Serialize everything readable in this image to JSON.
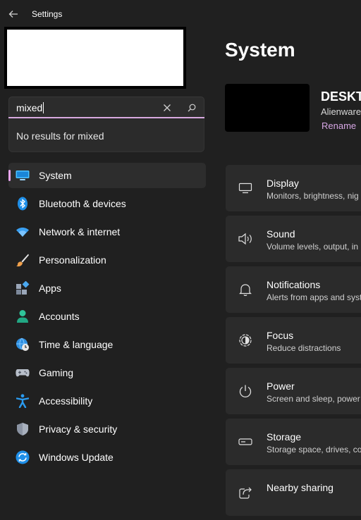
{
  "app": {
    "title": "Settings"
  },
  "search": {
    "value": "mixed",
    "no_results": "No results for mixed"
  },
  "sidebar": {
    "items": [
      {
        "label": "System",
        "icon": "monitor-icon",
        "selected": true
      },
      {
        "label": "Bluetooth & devices",
        "icon": "bluetooth-icon"
      },
      {
        "label": "Network & internet",
        "icon": "wifi-icon"
      },
      {
        "label": "Personalization",
        "icon": "brush-icon"
      },
      {
        "label": "Apps",
        "icon": "apps-icon"
      },
      {
        "label": "Accounts",
        "icon": "person-icon"
      },
      {
        "label": "Time & language",
        "icon": "globe-clock-icon"
      },
      {
        "label": "Gaming",
        "icon": "gamepad-icon"
      },
      {
        "label": "Accessibility",
        "icon": "accessibility-icon"
      },
      {
        "label": "Privacy & security",
        "icon": "shield-icon"
      },
      {
        "label": "Windows Update",
        "icon": "update-icon"
      }
    ]
  },
  "main": {
    "title": "System",
    "device": {
      "name": "DESKTO",
      "model": "Alienware",
      "rename": "Rename"
    },
    "settings": [
      {
        "title": "Display",
        "subtitle": "Monitors, brightness, nig",
        "icon": "display-icon"
      },
      {
        "title": "Sound",
        "subtitle": "Volume levels, output, in",
        "icon": "speaker-icon"
      },
      {
        "title": "Notifications",
        "subtitle": "Alerts from apps and syst",
        "icon": "bell-icon"
      },
      {
        "title": "Focus",
        "subtitle": "Reduce distractions",
        "icon": "focus-icon"
      },
      {
        "title": "Power",
        "subtitle": "Screen and sleep, power",
        "icon": "power-icon"
      },
      {
        "title": "Storage",
        "subtitle": "Storage space, drives, co",
        "icon": "storage-icon"
      },
      {
        "title": "Nearby sharing",
        "subtitle": "",
        "icon": "share-icon"
      }
    ]
  },
  "colors": {
    "background": "#202020",
    "card": "#2b2b2b",
    "accent": "#e8a6ef",
    "link": "#d6a6e4"
  }
}
